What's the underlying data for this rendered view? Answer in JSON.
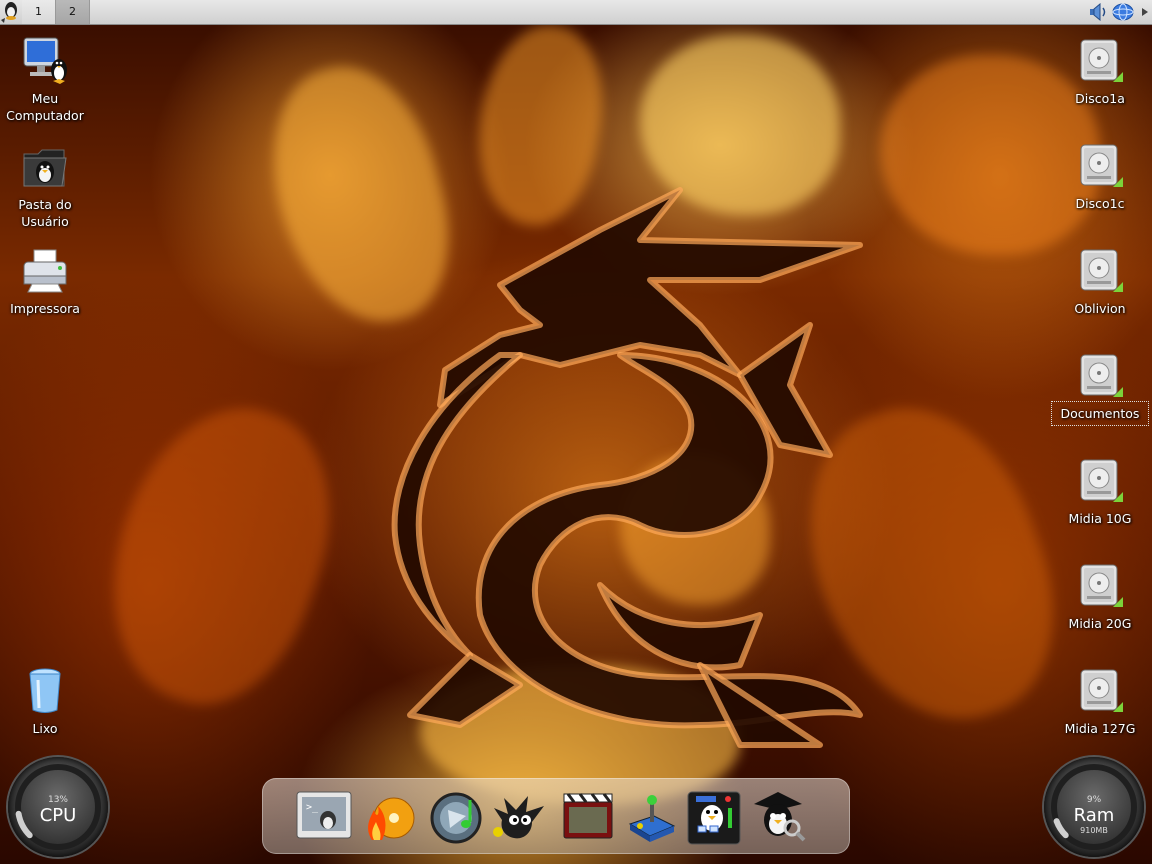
{
  "top_panel": {
    "desktops": [
      "1",
      "2"
    ],
    "active_desktop": "2",
    "tray_icons": [
      "volume-icon",
      "network-globe-icon"
    ]
  },
  "desktop_left": [
    {
      "label_lines": [
        "Meu",
        "Computador"
      ],
      "icon": "computer-tux-icon"
    },
    {
      "label_lines": [
        "Pasta do",
        "Usuário"
      ],
      "icon": "home-folder-icon"
    },
    {
      "label_lines": [
        "Impressora"
      ],
      "icon": "printer-icon"
    },
    {
      "label_lines": [
        "Lixo"
      ],
      "icon": "trash-icon"
    }
  ],
  "desktop_right": [
    {
      "label": "Disco1a",
      "icon": "hard-drive-icon"
    },
    {
      "label": "Disco1c",
      "icon": "hard-drive-icon"
    },
    {
      "label": "Oblivion",
      "icon": "hard-drive-icon"
    },
    {
      "label": "Documentos",
      "icon": "hard-drive-icon",
      "selected": true
    },
    {
      "label": "Midia 10G",
      "icon": "hard-drive-icon"
    },
    {
      "label": "Midia 20G",
      "icon": "hard-drive-icon"
    },
    {
      "label": "Midia 127G",
      "icon": "hard-drive-icon"
    }
  ],
  "gauges": {
    "cpu": {
      "percent_text": "13%",
      "name": "CPU",
      "value_fraction": 0.13
    },
    "ram": {
      "percent_text": "9%",
      "name": "Ram",
      "sub": "910MB",
      "value_fraction": 0.09
    }
  },
  "dock": {
    "items": [
      "terminal-icon",
      "cd-burner-icon",
      "music-player-icon",
      "gimp-icon",
      "video-clapper-icon",
      "joystick-icon",
      "system-settings-icon",
      "search-tux-icon"
    ]
  },
  "colors": {
    "panel": "#d6d6d6",
    "flame_bright": "#ffb040",
    "flame_dark": "#3a0e00",
    "drive_led": "#7cd33a"
  }
}
